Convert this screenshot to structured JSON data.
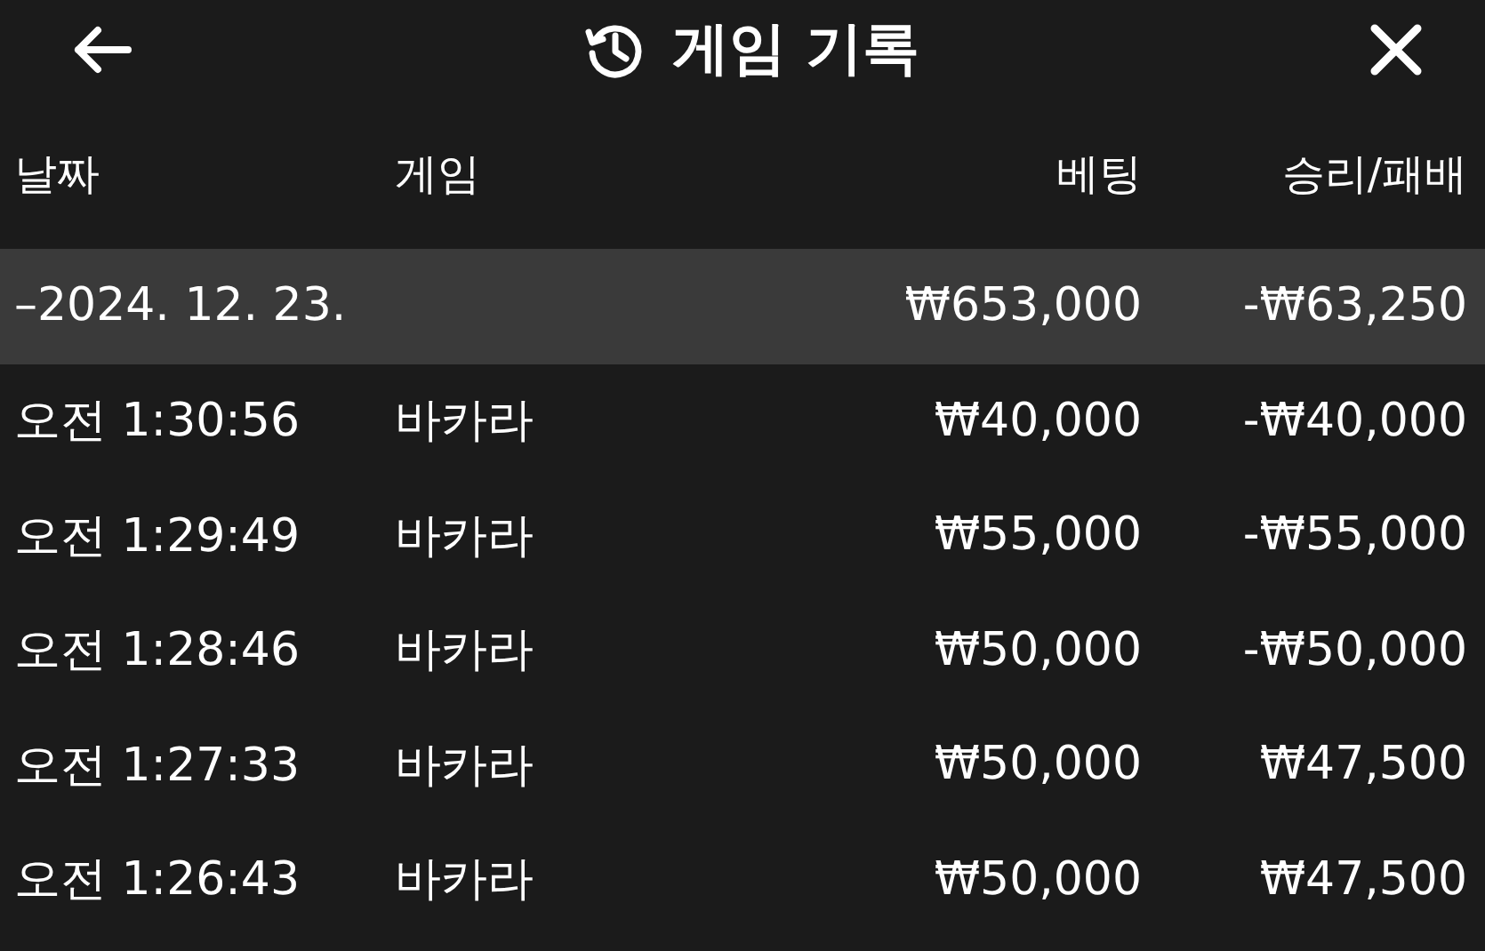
{
  "header": {
    "title": "게임 기록"
  },
  "table": {
    "columns": [
      "날짜",
      "게임",
      "베팅",
      "승리/패배"
    ],
    "groups": [
      {
        "date": "–2024. 12. 23.",
        "bet": "₩653,000",
        "result": "-₩63,250",
        "rows": [
          {
            "time": "오전 1:30:56",
            "game": "바카라",
            "bet": "₩40,000",
            "result": "-₩40,000"
          },
          {
            "time": "오전 1:29:49",
            "game": "바카라",
            "bet": "₩55,000",
            "result": "-₩55,000"
          },
          {
            "time": "오전 1:28:46",
            "game": "바카라",
            "bet": "₩50,000",
            "result": "-₩50,000"
          },
          {
            "time": "오전 1:27:33",
            "game": "바카라",
            "bet": "₩50,000",
            "result": "₩47,500"
          },
          {
            "time": "오전 1:26:43",
            "game": "바카라",
            "bet": "₩50,000",
            "result": "₩47,500"
          }
        ]
      }
    ]
  }
}
